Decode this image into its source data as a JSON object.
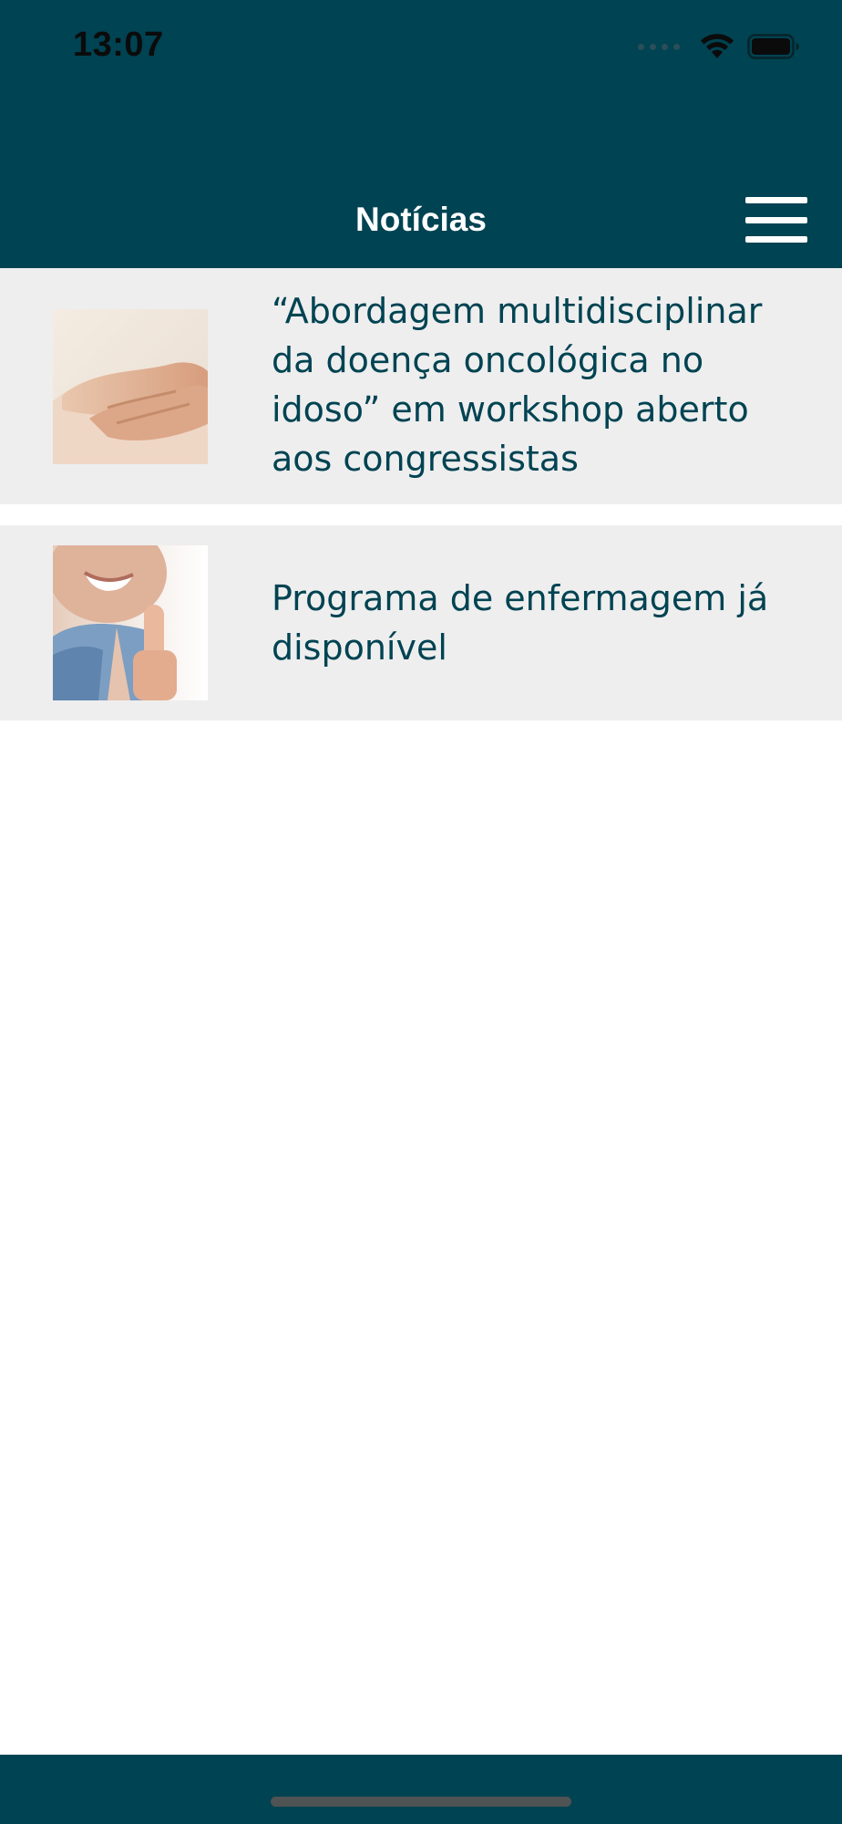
{
  "status_bar": {
    "time": "13:07"
  },
  "header": {
    "title": "Notícias",
    "menu_icon": "hamburger-menu-icon"
  },
  "news": [
    {
      "headline": "“Abordagem multidisciplinar da doença oncológica no idoso” em workshop aberto aos congressistas",
      "image": "holding-hands-photo"
    },
    {
      "headline": "Programa de enfermagem já disponível",
      "image": "nurse-thumbs-up-photo"
    }
  ],
  "colors": {
    "header_bg": "#004352",
    "item_bg": "#eeeeee",
    "headline_text": "#004352"
  }
}
